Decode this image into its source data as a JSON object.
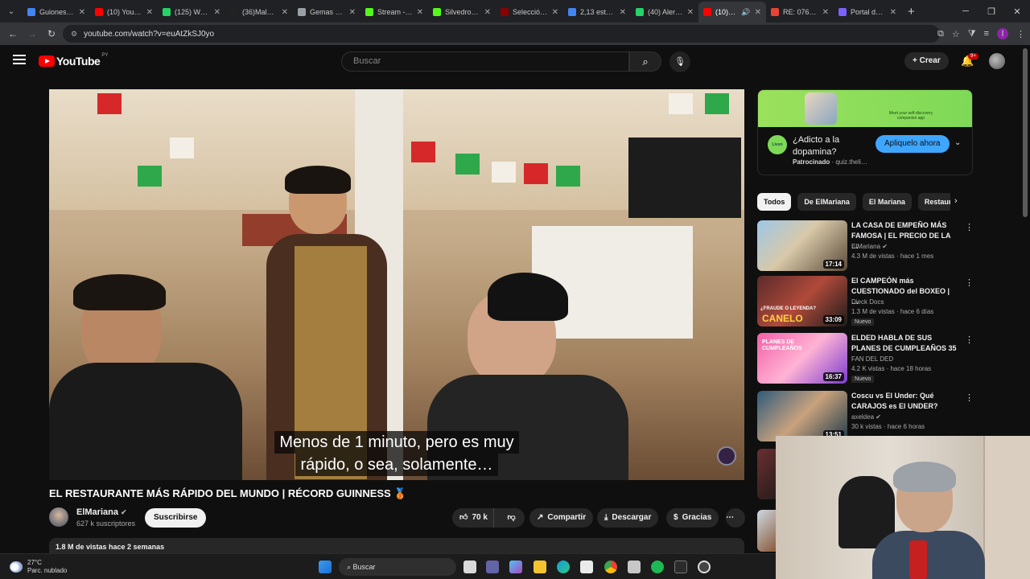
{
  "browser": {
    "tabs": [
      {
        "title": "Guiones t…",
        "color": "#4285f4",
        "active": false
      },
      {
        "title": "(10) YouTu…",
        "color": "#ff0000",
        "active": false
      },
      {
        "title": "(125) Wha…",
        "color": "#25d366",
        "active": false
      },
      {
        "title": "(36)Malun…",
        "color": "#222222",
        "active": false
      },
      {
        "title": "Gemas de…",
        "color": "#9aa0a6",
        "active": false
      },
      {
        "title": "Stream - K…",
        "color": "#53fc18",
        "active": false
      },
      {
        "title": "Silvedroke…",
        "color": "#53fc18",
        "active": false
      },
      {
        "title": "Selección…",
        "color": "#8b0000",
        "active": false
      },
      {
        "title": "2,13 estat…",
        "color": "#4285f4",
        "active": false
      },
      {
        "title": "(40) Alert…",
        "color": "#25d366",
        "active": false
      },
      {
        "title": "(10) El…",
        "color": "#ff0000",
        "active": true
      },
      {
        "title": "RE: 07629…",
        "color": "#ea4335",
        "active": false
      },
      {
        "title": "Portal de…",
        "color": "#7b61ff",
        "active": false
      }
    ],
    "url": "youtube.com/watch?v=euAtZkSJ0yo",
    "profile_letter": "I"
  },
  "youtube": {
    "logo_text": "YouTube",
    "country": "PY",
    "search_placeholder": "Buscar",
    "create_label": "Crear",
    "notif_count": "9+"
  },
  "video": {
    "subtitle_line1": "Menos de 1 minuto, pero es muy",
    "subtitle_line2": "rápido, o sea, solamente…",
    "title": "EL RESTAURANTE MÁS RÁPIDO DEL MUNDO | RÉCORD GUINNESS 🥉",
    "channel": "ElMariana",
    "subscribers": "627 k suscriptores",
    "subscribe_label": "Suscribirse",
    "likes": "70 k",
    "share_label": "Compartir",
    "download_label": "Descargar",
    "thanks_label": "Gracias",
    "views_date": "1.8 M de vistas  hace 2 semanas"
  },
  "ad": {
    "banner_text": "Meet your self-discovery companion app",
    "title": "¿Adicto a la dopamina?",
    "sponsored": "Patrocinado",
    "domain": "· quiz.theli…",
    "cta": "Apliquelo ahora"
  },
  "chips": [
    "Todos",
    "De ElMariana",
    "El Mariana",
    "Restaurantes"
  ],
  "recommendations": [
    {
      "title": "LA CASA DE EMPEÑO MÁS FAMOSA | EL PRECIO DE LA …",
      "channel": "ElMariana",
      "verified": true,
      "meta": "4.3 M de vistas · hace 1 mes",
      "duration": "17:14",
      "badge": ""
    },
    {
      "title": "El CAMPEÓN más CUESTIONADO del BOXEO  | …",
      "channel": "Dieck Docs",
      "verified": false,
      "meta": "1.3 M de vistas · hace 6 días",
      "duration": "33:09",
      "badge": "Nuevo"
    },
    {
      "title": "ELDED HABLA DE SUS PLANES DE CUMPLEAÑOS 35",
      "channel": "FAN DEL DED",
      "verified": false,
      "meta": "4.2 K vistas · hace 18 horas",
      "duration": "16:37",
      "badge": "Nuevo"
    },
    {
      "title": "Coscu vs El Under: Qué CARAJOS es El UNDER?",
      "channel": "axeldea",
      "verified": true,
      "meta": "30 k vistas · hace 6 horas",
      "duration": "13:51",
      "badge": ""
    }
  ],
  "thumb_texts": {
    "rec2": "CANELO",
    "rec2_top": "¿FRAUDE O LEYENDA?",
    "rec3": "PLANES DE CUMPLEAÑOS"
  },
  "taskbar": {
    "temp": "27°C",
    "weather": "Parc. nublado",
    "search": "Buscar"
  }
}
